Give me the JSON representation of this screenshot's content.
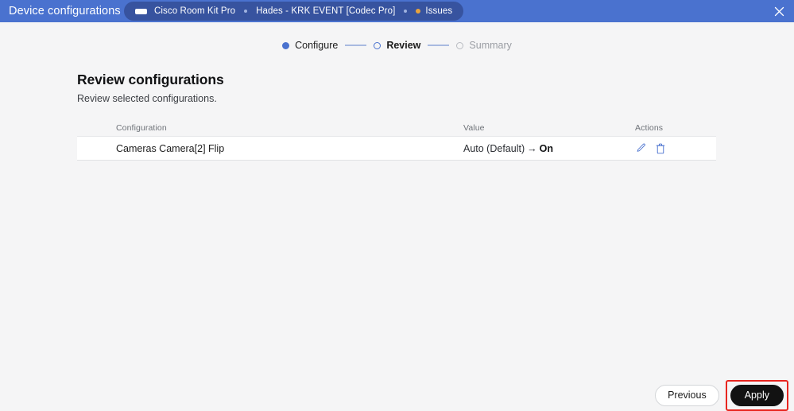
{
  "header": {
    "title": "Device configurations",
    "device_icon": "device-monitor-icon",
    "close_icon": "close-icon",
    "breadcrumb": {
      "device_name": "Cisco Room Kit Pro",
      "room_name": "Hades - KRK EVENT [Codec Pro]",
      "issues_label": "Issues",
      "issues_dot_color": "#e8a33d",
      "chip_bg": "#37539f"
    },
    "bg_color": "#4a72cf"
  },
  "stepper": {
    "steps": [
      {
        "label": "Configure",
        "state": "done"
      },
      {
        "label": "Review",
        "state": "current"
      },
      {
        "label": "Summary",
        "state": "todo"
      }
    ],
    "accent_color": "#4a72cf"
  },
  "main": {
    "title": "Review configurations",
    "subtitle": "Review selected configurations.",
    "table": {
      "columns": [
        "Configuration",
        "Value",
        "Actions"
      ],
      "rows": [
        {
          "configuration": "Cameras Camera[2] Flip",
          "value_old": "Auto (Default)",
          "value_arrow": "→",
          "value_new": "On",
          "actions": [
            "edit-icon",
            "delete-icon"
          ]
        }
      ]
    }
  },
  "footer": {
    "previous_label": "Previous",
    "apply_label": "Apply",
    "apply_highlight_color": "#e8251f"
  }
}
